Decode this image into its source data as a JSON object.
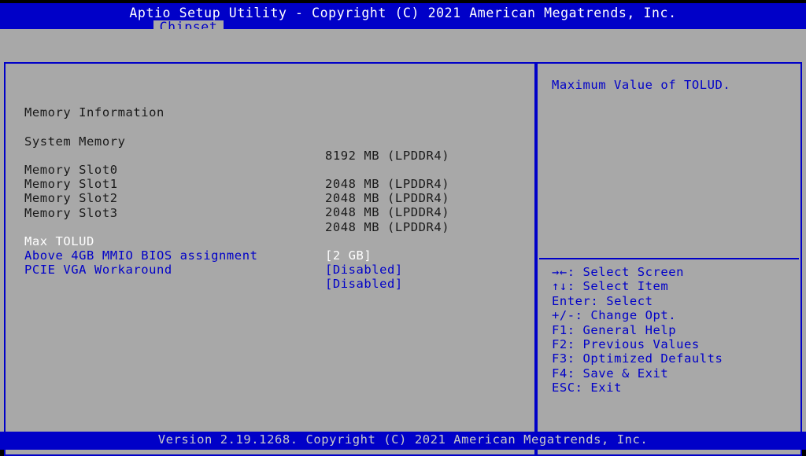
{
  "header": {
    "title": "Aptio Setup Utility - Copyright (C) 2021 American Megatrends, Inc.",
    "active_tab": "Chipset",
    "colors": {
      "bar_background": "#0000c8",
      "bar_text": "#ffffff",
      "tab_background": "#a8a8a8",
      "tab_text": "#0000c8"
    }
  },
  "main": {
    "section_heading": "Memory Information",
    "info_rows": [
      {
        "label": "System Memory",
        "value": "8192 MB (LPDDR4)",
        "style": "dark"
      },
      {
        "label": "Memory Slot0",
        "value": "2048 MB (LPDDR4)",
        "style": "dark"
      },
      {
        "label": "Memory Slot1",
        "value": "2048 MB (LPDDR4)",
        "style": "dark"
      },
      {
        "label": "Memory Slot2",
        "value": "2048 MB (LPDDR4)",
        "style": "dark"
      },
      {
        "label": "Memory Slot3",
        "value": "2048 MB (LPDDR4)",
        "style": "dark"
      }
    ],
    "setting_rows": [
      {
        "label": "Max TOLUD",
        "value": "[2 GB]",
        "style": "selected"
      },
      {
        "label": "Above 4GB MMIO BIOS assignment",
        "value": "[Disabled]",
        "style": "normal"
      },
      {
        "label": "PCIE VGA Workaround",
        "value": "[Disabled]",
        "style": "normal"
      }
    ]
  },
  "help": {
    "text": "Maximum Value of TOLUD.",
    "legend": [
      {
        "keys": "→←:",
        "action": "Select Screen"
      },
      {
        "keys": "↑↓:",
        "action": "Select Item"
      },
      {
        "keys": "Enter:",
        "action": "Select"
      },
      {
        "keys": "+/-:",
        "action": "Change Opt."
      },
      {
        "keys": "F1:",
        "action": "General Help"
      },
      {
        "keys": "F2:",
        "action": "Previous Values"
      },
      {
        "keys": "F3:",
        "action": "Optimized Defaults"
      },
      {
        "keys": "F4:",
        "action": "Save & Exit"
      },
      {
        "keys": "ESC:",
        "action": "Exit"
      }
    ]
  },
  "footer": {
    "text": "Version 2.19.1268. Copyright (C) 2021 American Megatrends, Inc."
  },
  "theme": {
    "background": "#a8a8a8",
    "accent_blue": "#0000c8",
    "text_dark": "#1a1a1a",
    "text_white": "#ffffff",
    "footer_text": "#c8c8c8"
  }
}
